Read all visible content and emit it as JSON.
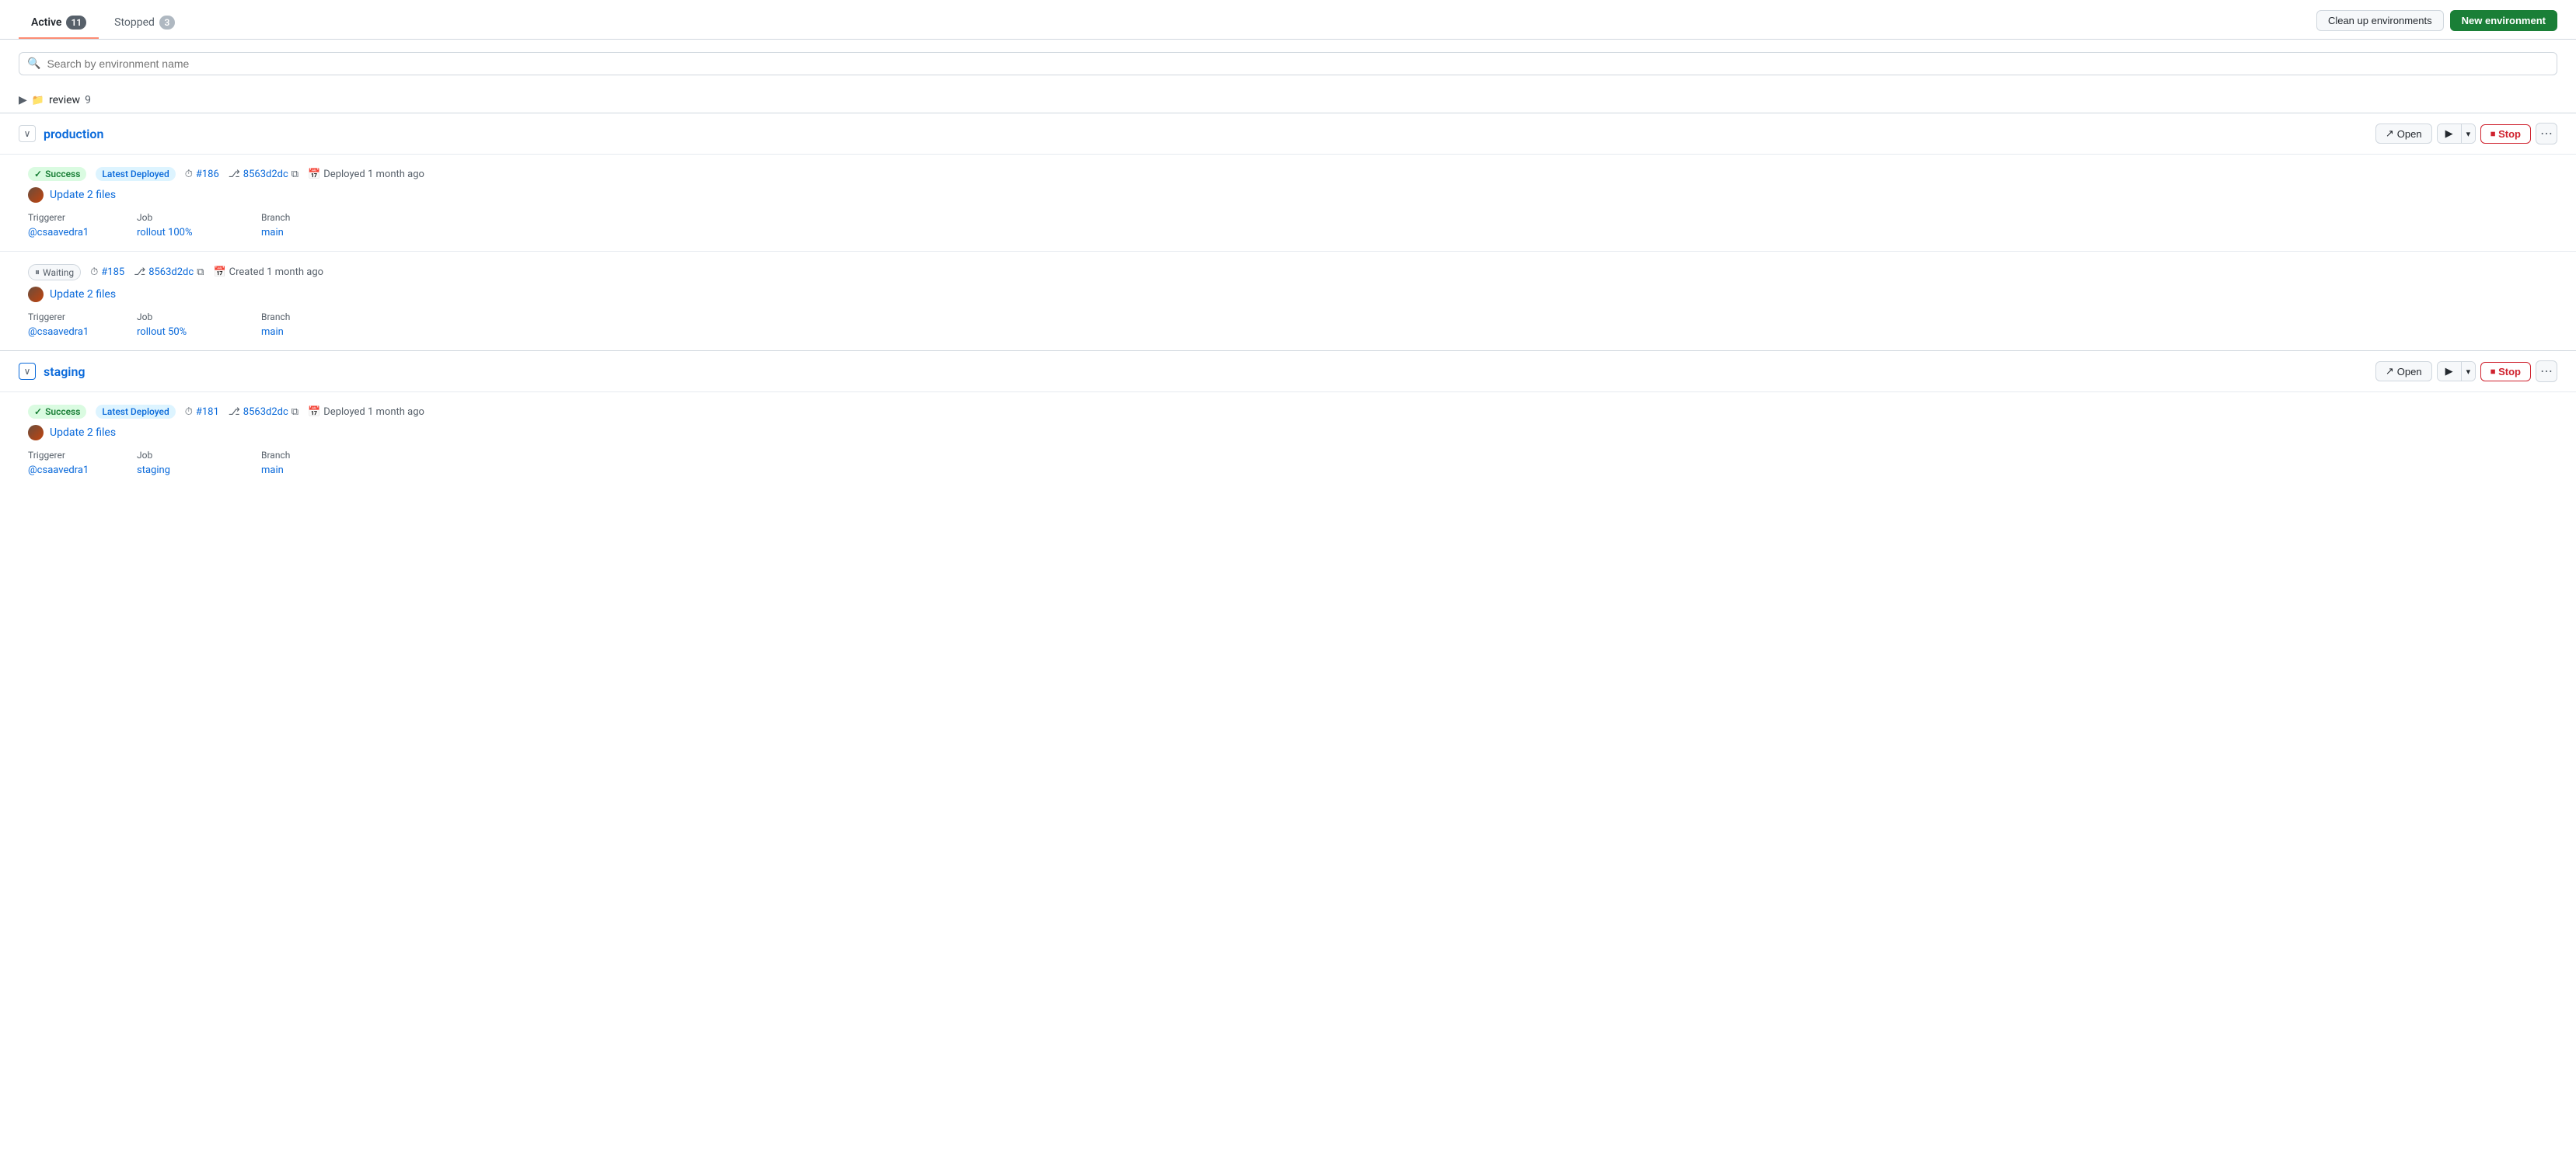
{
  "tabs": {
    "active_label": "Active",
    "active_count": "11",
    "stopped_label": "Stopped",
    "stopped_count": "3"
  },
  "buttons": {
    "cleanup": "Clean up environments",
    "new_env": "New environment"
  },
  "search": {
    "placeholder": "Search by environment name"
  },
  "review_group": {
    "name": "review",
    "count": "9",
    "expand_icon": "▶",
    "folder_icon": "📁"
  },
  "environments": [
    {
      "id": "production",
      "name": "production",
      "expanded": true,
      "deployments": [
        {
          "status": "Success",
          "latest": true,
          "pipeline_num": "#186",
          "commit_hash": "8563d2dc",
          "time_label": "Deployed 1 month ago",
          "title": "Update 2 files",
          "triggerer": "@csaavedra1",
          "job": "rollout 100%",
          "branch": "main",
          "waiting": false
        },
        {
          "status": "Waiting",
          "latest": false,
          "pipeline_num": "#185",
          "commit_hash": "8563d2dc",
          "time_label": "Created 1 month ago",
          "title": "Update 2 files",
          "triggerer": "@csaavedra1",
          "job": "rollout 50%",
          "branch": "main",
          "waiting": true
        }
      ]
    },
    {
      "id": "staging",
      "name": "staging",
      "expanded": true,
      "deployments": [
        {
          "status": "Success",
          "latest": true,
          "pipeline_num": "#181",
          "commit_hash": "8563d2dc",
          "time_label": "Deployed 1 month ago",
          "title": "Update 2 files",
          "triggerer": "@csaavedra1",
          "job": "staging",
          "branch": "main",
          "waiting": false
        }
      ]
    }
  ],
  "labels": {
    "triggerer": "Triggerer",
    "job": "Job",
    "branch": "Branch",
    "open": "Open",
    "stop": "Stop",
    "success_check": "✓",
    "waiting_circle": "⏸"
  }
}
